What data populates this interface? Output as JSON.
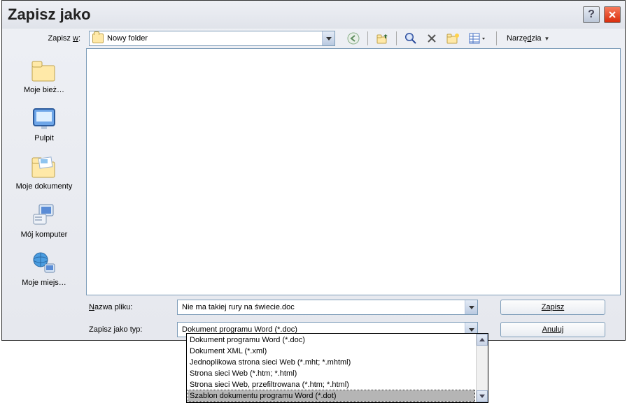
{
  "title": "Zapisz jako",
  "saveIn": {
    "label": "Zapisz w:",
    "value": "Nowy folder"
  },
  "toolsLabel": "Narzędzia",
  "places": [
    {
      "key": "recent",
      "label": "Moje bież…"
    },
    {
      "key": "desktop",
      "label": "Pulpit"
    },
    {
      "key": "docs",
      "label": "Moje dokumenty"
    },
    {
      "key": "computer",
      "label": "Mój komputer"
    },
    {
      "key": "network",
      "label": "Moje miejs…"
    }
  ],
  "filename": {
    "label": "Nazwa pliku:",
    "value": "Nie ma takiej rury na świecie.doc"
  },
  "saveType": {
    "label": "Zapisz jako typ:",
    "value": "Dokument programu Word (*.doc)"
  },
  "buttons": {
    "save": "Zapisz",
    "cancel": "Anuluj"
  },
  "typeOptions": [
    "Dokument programu Word (*.doc)",
    "Dokument XML (*.xml)",
    "Jednoplikowa strona sieci Web (*.mht; *.mhtml)",
    "Strona sieci Web (*.htm; *.html)",
    "Strona sieci Web, przefiltrowana (*.htm; *.html)",
    "Szablon dokumentu programu Word (*.dot)"
  ],
  "selectedTypeIndex": 5
}
